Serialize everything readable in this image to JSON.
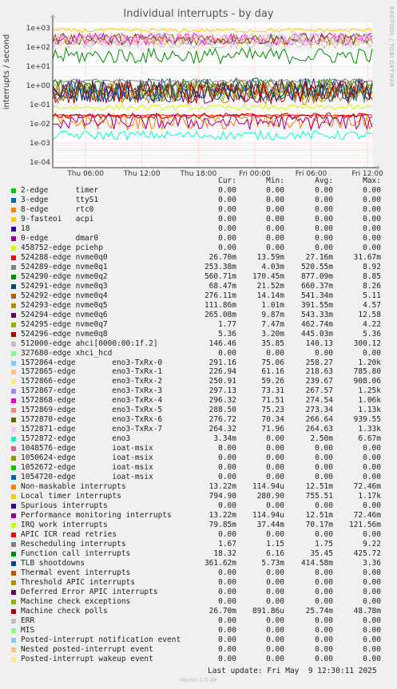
{
  "title": "Individual interrupts - by day",
  "side_label": "RRDTOOL / TOBI OETIKER",
  "footer": "Munin 2.0.49",
  "last_update": "Last update: Fri May  9 12:30:11 2025",
  "legend_header": {
    "cur": "Cur:",
    "min": "Min:",
    "avg": "Avg:",
    "max": "Max:"
  },
  "chart_data": {
    "type": "line",
    "title": "Individual interrupts - by day",
    "ylabel": "interrupts / second",
    "xlabel": "",
    "yscale": "log",
    "ylim": [
      5e-05,
      2000
    ],
    "ytick_labels": [
      "1e-04",
      "1e-03",
      "1e-02",
      "1e-01",
      "1e+00",
      "1e+01",
      "1e+02",
      "1e+03"
    ],
    "ytick_values": [
      0.0001,
      0.001,
      0.01,
      0.1,
      1,
      10,
      100,
      1000
    ],
    "xtick_labels": [
      "Thu 06:00",
      "Thu 12:00",
      "Thu 18:00",
      "Fri 00:00",
      "Fri 06:00",
      "Fri 12:00"
    ],
    "xtick_hours": [
      6,
      12,
      18,
      24,
      30,
      36
    ],
    "xlim_hours": [
      2.5,
      36.5
    ],
    "grid": true,
    "legend_placement": "bottom",
    "series": [
      {
        "name": "2-edge",
        "sub": "timer",
        "color": "#00cc00",
        "cur": "0.00",
        "min": "0.00",
        "avg": "0.00",
        "max": "0.00"
      },
      {
        "name": "3-edge",
        "sub": "ttyS1",
        "color": "#0066b3",
        "cur": "0.00",
        "min": "0.00",
        "avg": "0.00",
        "max": "0.00"
      },
      {
        "name": "8-edge",
        "sub": "rtc0",
        "color": "#ff8000",
        "cur": "0.00",
        "min": "0.00",
        "avg": "0.00",
        "max": "0.00"
      },
      {
        "name": "9-fasteoi",
        "sub": "acpi",
        "color": "#ffcc00",
        "cur": "0.00",
        "min": "0.00",
        "avg": "0.00",
        "max": "0.00"
      },
      {
        "name": "18",
        "sub": "",
        "color": "#330099",
        "cur": "0.00",
        "min": "0.00",
        "avg": "0.00",
        "max": "0.00"
      },
      {
        "name": "0-edge",
        "sub": "dmar0",
        "color": "#990099",
        "cur": "0.00",
        "min": "0.00",
        "avg": "0.00",
        "max": "0.00"
      },
      {
        "name": "458752-edge",
        "sub": "pciehp",
        "color": "#ccff00",
        "cur": "0.00",
        "min": "0.00",
        "avg": "0.00",
        "max": "0.00"
      },
      {
        "name": "524288-edge",
        "sub": "nvme0q0",
        "color": "#ff0000",
        "cur": "26.70m",
        "min": "13.59m",
        "avg": "27.16m",
        "max": "31.67m"
      },
      {
        "name": "524289-edge",
        "sub": "nvme0q1",
        "color": "#808080",
        "cur": "253.38m",
        "min": "4.03m",
        "avg": "520.55m",
        "max": "8.92"
      },
      {
        "name": "524290-edge",
        "sub": "nvme0q2",
        "color": "#008f00",
        "cur": "560.71m",
        "min": "170.45m",
        "avg": "877.09m",
        "max": "8.85"
      },
      {
        "name": "524291-edge",
        "sub": "nvme0q3",
        "color": "#00487d",
        "cur": "68.47m",
        "min": "21.52m",
        "avg": "660.37m",
        "max": "8.26"
      },
      {
        "name": "524292-edge",
        "sub": "nvme0q4",
        "color": "#b35a00",
        "cur": "276.11m",
        "min": "14.14m",
        "avg": "541.34m",
        "max": "5.11"
      },
      {
        "name": "524293-edge",
        "sub": "nvme0q5",
        "color": "#b38f00",
        "cur": "111.86m",
        "min": "1.01m",
        "avg": "391.55m",
        "max": "4.57"
      },
      {
        "name": "524294-edge",
        "sub": "nvme0q6",
        "color": "#6b006b",
        "cur": "265.08m",
        "min": "9.87m",
        "avg": "543.33m",
        "max": "12.58"
      },
      {
        "name": "524295-edge",
        "sub": "nvme0q7",
        "color": "#8fb300",
        "cur": "1.77",
        "min": "7.47m",
        "avg": "462.74m",
        "max": "4.22"
      },
      {
        "name": "524296-edge",
        "sub": "nvme0q8",
        "color": "#b30000",
        "cur": "5.36",
        "min": "3.20m",
        "avg": "445.03m",
        "max": "5.36"
      },
      {
        "name": "512000-edge",
        "sub": "ahci[0000:00:1f.2]",
        "color": "#bebebe",
        "cur": "146.46",
        "min": "35.85",
        "avg": "140.13",
        "max": "300.12"
      },
      {
        "name": "327680-edge",
        "sub": "xhci_hcd",
        "color": "#80ff80",
        "cur": "0.00",
        "min": "0.00",
        "avg": "0.00",
        "max": "0.00"
      },
      {
        "name": "1572864-edge",
        "sub": "eno3-TxRx-0",
        "color": "#80c9ff",
        "cur": "291.16",
        "min": "75.06",
        "avg": "258.27",
        "max": "1.20k"
      },
      {
        "name": "1572865-edge",
        "sub": "eno3-TxRx-1",
        "color": "#ffc080",
        "cur": "226.94",
        "min": "61.16",
        "avg": "218.63",
        "max": "785.80"
      },
      {
        "name": "1572866-edge",
        "sub": "eno3-TxRx-2",
        "color": "#ffe680",
        "cur": "250.91",
        "min": "59.26",
        "avg": "239.67",
        "max": "908.06"
      },
      {
        "name": "1572867-edge",
        "sub": "eno3-TxRx-3",
        "color": "#aa80ff",
        "cur": "297.13",
        "min": "73.31",
        "avg": "267.57",
        "max": "1.25k"
      },
      {
        "name": "1572868-edge",
        "sub": "eno3-TxRx-4",
        "color": "#ee00cc",
        "cur": "296.32",
        "min": "71.51",
        "avg": "274.54",
        "max": "1.06k"
      },
      {
        "name": "1572869-edge",
        "sub": "eno3-TxRx-5",
        "color": "#ff8080",
        "cur": "288.50",
        "min": "75.23",
        "avg": "273.34",
        "max": "1.13k"
      },
      {
        "name": "1572870-edge",
        "sub": "eno3-TxRx-6",
        "color": "#666600",
        "cur": "276.72",
        "min": "70.34",
        "avg": "266.64",
        "max": "939.55"
      },
      {
        "name": "1572871-edge",
        "sub": "eno3-TxRx-7",
        "color": "#ffbfff",
        "cur": "264.32",
        "min": "71.96",
        "avg": "264.63",
        "max": "1.33k"
      },
      {
        "name": "1572872-edge",
        "sub": "eno3",
        "color": "#00ffcc",
        "cur": "3.34m",
        "min": "0.00",
        "avg": "2.50m",
        "max": "6.67m"
      },
      {
        "name": "1048576-edge",
        "sub": "ioat-msix",
        "color": "#cc6699",
        "cur": "0.00",
        "min": "0.00",
        "avg": "0.00",
        "max": "0.00"
      },
      {
        "name": "1050624-edge",
        "sub": "ioat-msix",
        "color": "#999900",
        "cur": "0.00",
        "min": "0.00",
        "avg": "0.00",
        "max": "0.00"
      },
      {
        "name": "1052672-edge",
        "sub": "ioat-msix",
        "color": "#00cc00",
        "cur": "0.00",
        "min": "0.00",
        "avg": "0.00",
        "max": "0.00"
      },
      {
        "name": "1054720-edge",
        "sub": "ioat-msix",
        "color": "#0066b3",
        "cur": "0.00",
        "min": "0.00",
        "avg": "0.00",
        "max": "0.00"
      },
      {
        "name": "Non-maskable interrupts",
        "sub": "",
        "color": "#ff8000",
        "cur": "13.22m",
        "min": "114.94u",
        "avg": "12.51m",
        "max": "72.46m"
      },
      {
        "name": "Local timer interrupts",
        "sub": "",
        "color": "#ffcc00",
        "cur": "794.90",
        "min": "280.90",
        "avg": "755.51",
        "max": "1.17k"
      },
      {
        "name": "Spurious interrupts",
        "sub": "",
        "color": "#330099",
        "cur": "0.00",
        "min": "0.00",
        "avg": "0.00",
        "max": "0.00"
      },
      {
        "name": "Performance monitoring interrupts",
        "sub": "",
        "color": "#990099",
        "cur": "13.22m",
        "min": "114.94u",
        "avg": "12.51m",
        "max": "72.46m"
      },
      {
        "name": "IRQ work interrupts",
        "sub": "",
        "color": "#ccff00",
        "cur": "79.85m",
        "min": "37.44m",
        "avg": "70.17m",
        "max": "121.56m"
      },
      {
        "name": "APIC ICR read retries",
        "sub": "",
        "color": "#ff0000",
        "cur": "0.00",
        "min": "0.00",
        "avg": "0.00",
        "max": "0.00"
      },
      {
        "name": "Rescheduling interrupts",
        "sub": "",
        "color": "#808080",
        "cur": "1.67",
        "min": "1.15",
        "avg": "1.75",
        "max": "9.22"
      },
      {
        "name": "Function call interrupts",
        "sub": "",
        "color": "#008f00",
        "cur": "18.32",
        "min": "6.16",
        "avg": "35.45",
        "max": "425.72"
      },
      {
        "name": "TLB shootdowns",
        "sub": "",
        "color": "#00487d",
        "cur": "361.62m",
        "min": "5.73m",
        "avg": "414.58m",
        "max": "3.36"
      },
      {
        "name": "Thermal event interrupts",
        "sub": "",
        "color": "#b35a00",
        "cur": "0.00",
        "min": "0.00",
        "avg": "0.00",
        "max": "0.00"
      },
      {
        "name": "Threshold APIC interrupts",
        "sub": "",
        "color": "#b38f00",
        "cur": "0.00",
        "min": "0.00",
        "avg": "0.00",
        "max": "0.00"
      },
      {
        "name": "Deferred Error APIC interrupts",
        "sub": "",
        "color": "#6b006b",
        "cur": "0.00",
        "min": "0.00",
        "avg": "0.00",
        "max": "0.00"
      },
      {
        "name": "Machine check exceptions",
        "sub": "",
        "color": "#8fb300",
        "cur": "0.00",
        "min": "0.00",
        "avg": "0.00",
        "max": "0.00"
      },
      {
        "name": "Machine check polls",
        "sub": "",
        "color": "#b30000",
        "cur": "26.70m",
        "min": "891.86u",
        "avg": "25.74m",
        "max": "48.78m"
      },
      {
        "name": "ERR",
        "sub": "",
        "color": "#bebebe",
        "cur": "0.00",
        "min": "0.00",
        "avg": "0.00",
        "max": "0.00"
      },
      {
        "name": "MIS",
        "sub": "",
        "color": "#80ff80",
        "cur": "0.00",
        "min": "0.00",
        "avg": "0.00",
        "max": "0.00"
      },
      {
        "name": "Posted-interrupt notification event",
        "sub": "",
        "color": "#80c9ff",
        "cur": "0.00",
        "min": "0.00",
        "avg": "0.00",
        "max": "0.00"
      },
      {
        "name": "Nested posted-interrupt event",
        "sub": "",
        "color": "#ffc080",
        "cur": "0.00",
        "min": "0.00",
        "avg": "0.00",
        "max": "0.00"
      },
      {
        "name": "Posted-interrupt wakeup event",
        "sub": "",
        "color": "#ffe680",
        "cur": "0.00",
        "min": "0.00",
        "avg": "0.00",
        "max": "0.00"
      }
    ]
  }
}
